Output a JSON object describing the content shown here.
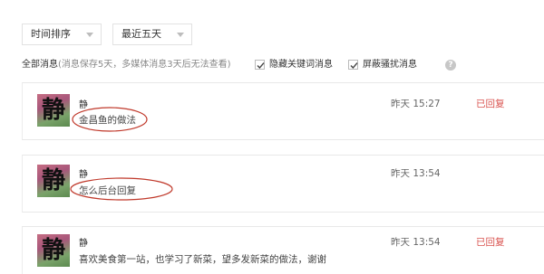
{
  "filters": {
    "sort": "时间排序",
    "range": "最近五天"
  },
  "filter_bar": {
    "all_messages": "全部消息",
    "storage_note": "(消息保存5天，多媒体消息3天后无法查看)",
    "hide_keyword": "隐藏关键词消息",
    "block_spam": "屏蔽骚扰消息",
    "help_glyph": "?"
  },
  "messages": [
    {
      "avatar_char": "静",
      "name": "静",
      "text": "金昌鱼的做法",
      "time": "昨天 15:27",
      "status": "已回复"
    },
    {
      "avatar_char": "静",
      "name": "静",
      "text": "怎么后台回复",
      "time": "昨天 13:54",
      "status": ""
    },
    {
      "avatar_char": "静",
      "name": "静",
      "text": "喜欢美食第一站，也学习了新菜，望多发新菜的做法，谢谢",
      "time": "昨天 13:54",
      "status": "已回复"
    }
  ],
  "colors": {
    "replied_status": "#d9534f",
    "annotation_circle": "#c0392b"
  }
}
